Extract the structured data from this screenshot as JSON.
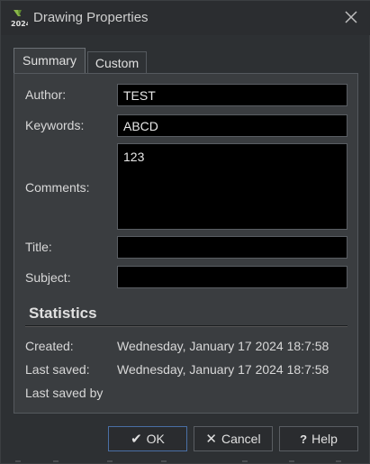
{
  "window": {
    "title": "Drawing Properties",
    "app_icon_text": "2024"
  },
  "tabs": [
    {
      "label": "Summary"
    },
    {
      "label": "Custom"
    }
  ],
  "summary": {
    "author_label": "Author:",
    "author_value": "TEST",
    "keywords_label": "Keywords:",
    "keywords_value": "ABCD",
    "comments_label": "Comments:",
    "comments_value": "123",
    "title_label": "Title:",
    "title_value": "",
    "subject_label": "Subject:",
    "subject_value": ""
  },
  "statistics": {
    "heading": "Statistics",
    "created_label": "Created:",
    "created_value": "Wednesday, January 17 2024 18:7:58",
    "last_saved_label": "Last saved:",
    "last_saved_value": "Wednesday, January 17 2024 18:7:58",
    "last_saved_by_label": "Last saved by",
    "last_saved_by_value": ""
  },
  "buttons": {
    "ok": "OK",
    "cancel": "Cancel",
    "help": "Help"
  },
  "icons": {
    "ok": "check-icon",
    "cancel": "x-icon",
    "help": "question-icon",
    "close": "close-icon"
  },
  "colors": {
    "window_bg": "#2d3033",
    "panel_bg": "#3a3d40",
    "field_bg": "#000000",
    "ok_border": "#4a6fa5"
  }
}
